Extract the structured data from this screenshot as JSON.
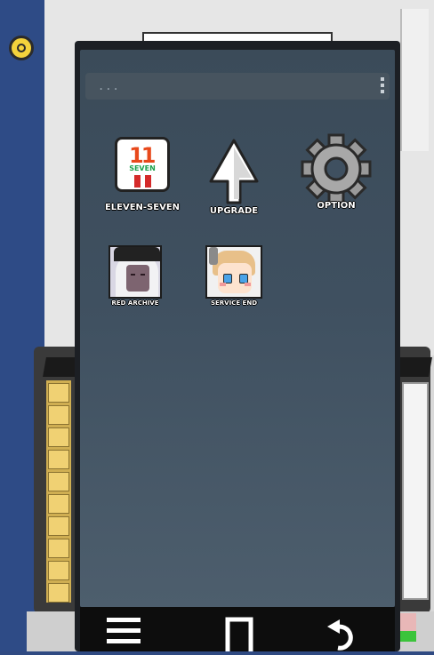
{
  "phone": {
    "search_dots": "...",
    "apps": [
      {
        "label": "ELEVEN-SEVEN",
        "icon": "eleven-seven-icon"
      },
      {
        "label": "UPGRADE",
        "icon": "upgrade-arrow-icon"
      },
      {
        "label": "OPTION",
        "icon": "gear-icon"
      },
      {
        "label": "RED ARCHIVE",
        "icon": "red-archive-icon"
      },
      {
        "label": "SERVICE END",
        "icon": "service-end-icon"
      }
    ],
    "eleven_seven_icon": {
      "digits": "11",
      "word": "SEVEN"
    },
    "navbar": [
      "menu-icon",
      "home-icon",
      "back-icon"
    ]
  },
  "colors": {
    "screen": "#3f5060",
    "phone_frame": "#1c1f24",
    "label_text": "#ffffff",
    "seven_orange": "#e8491b",
    "seven_green": "#1aa04a",
    "seven_red": "#d42a2a"
  }
}
